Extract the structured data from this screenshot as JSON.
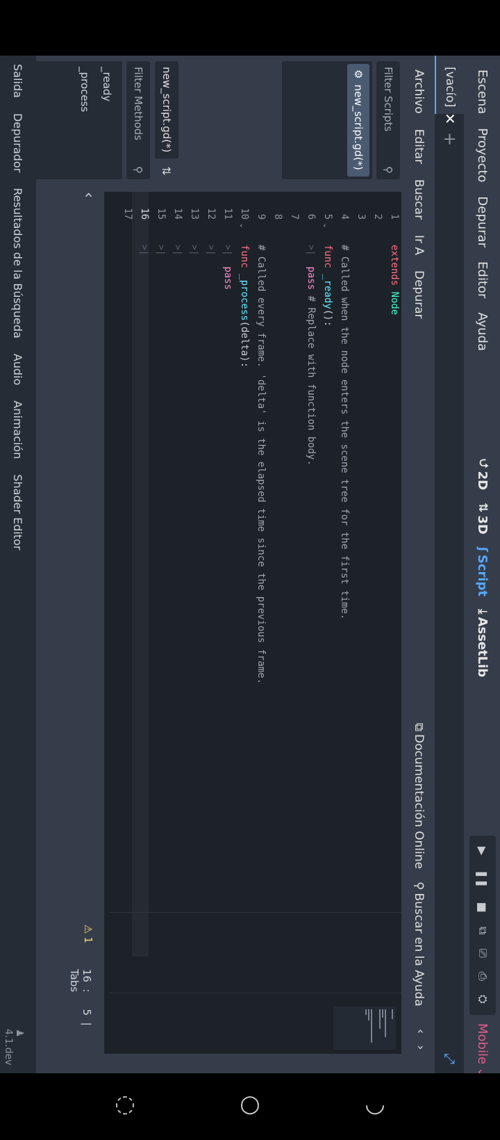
{
  "menubar": {
    "items": [
      "Escena",
      "Proyecto",
      "Depurar",
      "Editor",
      "Ayuda"
    ],
    "modes": [
      {
        "icon": "2d-icon",
        "label": "2D",
        "active": false
      },
      {
        "icon": "3d-icon",
        "label": "3D",
        "active": false
      },
      {
        "icon": "script-icon",
        "label": "Script",
        "active": true
      },
      {
        "icon": "assetlib-icon",
        "label": "AssetLib",
        "active": false
      }
    ],
    "renderer": "Mobile"
  },
  "tabs": {
    "scene_tab": "[vacío]"
  },
  "script_menu": {
    "items": [
      "Archivo",
      "Editar",
      "Buscar",
      "Ir A",
      "Depurar"
    ],
    "online_docs": "Documentación Online",
    "search_help": "Buscar en la Ayuda"
  },
  "left_panel": {
    "filter_scripts_placeholder": "Filter Scripts",
    "script_item": "new_script.gd(*)",
    "current_script": "new_script.gd(*)",
    "filter_methods_placeholder": "Filter Methods",
    "methods": [
      "_ready",
      "_process"
    ]
  },
  "code": {
    "lines": [
      {
        "n": "1"
      },
      {
        "n": "2"
      },
      {
        "n": "3"
      },
      {
        "n": "4"
      },
      {
        "n": "5"
      },
      {
        "n": "6"
      },
      {
        "n": "7"
      },
      {
        "n": "8"
      },
      {
        "n": "9"
      },
      {
        "n": "10"
      },
      {
        "n": "11"
      },
      {
        "n": "12"
      },
      {
        "n": "13"
      },
      {
        "n": "14"
      },
      {
        "n": "15"
      },
      {
        "n": "16"
      },
      {
        "n": "17"
      }
    ],
    "l1_kw": "extends",
    "l1_ty": "Node",
    "l4": "# Called when the node enters the scene tree for the first time.",
    "l5_kw": "func",
    "l5_fn": "_ready",
    "l5_rest": "():",
    "l6_kw": "pass",
    "l6_cm": "# Replace with function body.",
    "l9": "# Called every frame. 'delta' is the elapsed time since the previous frame.",
    "l10_kw": "func",
    "l10_fn": "_process",
    "l10_rest": "(delta):",
    "l11_kw": "pass"
  },
  "status": {
    "warnings": "1",
    "line": "16",
    "col": "5",
    "indent": "Tabs"
  },
  "bottom_panel": {
    "tabs": [
      "Salida",
      "Depurador",
      "Resultados de la Búsqueda",
      "Audio",
      "Animación",
      "Shader Editor"
    ],
    "version": "4.1.dev"
  },
  "colors": {
    "accent": "#57a6ff",
    "renderer": "#e15b8c",
    "keyword": "#ff7085",
    "type": "#42ffc2",
    "function": "#66e6ff",
    "comment": "#9fa6b0"
  }
}
